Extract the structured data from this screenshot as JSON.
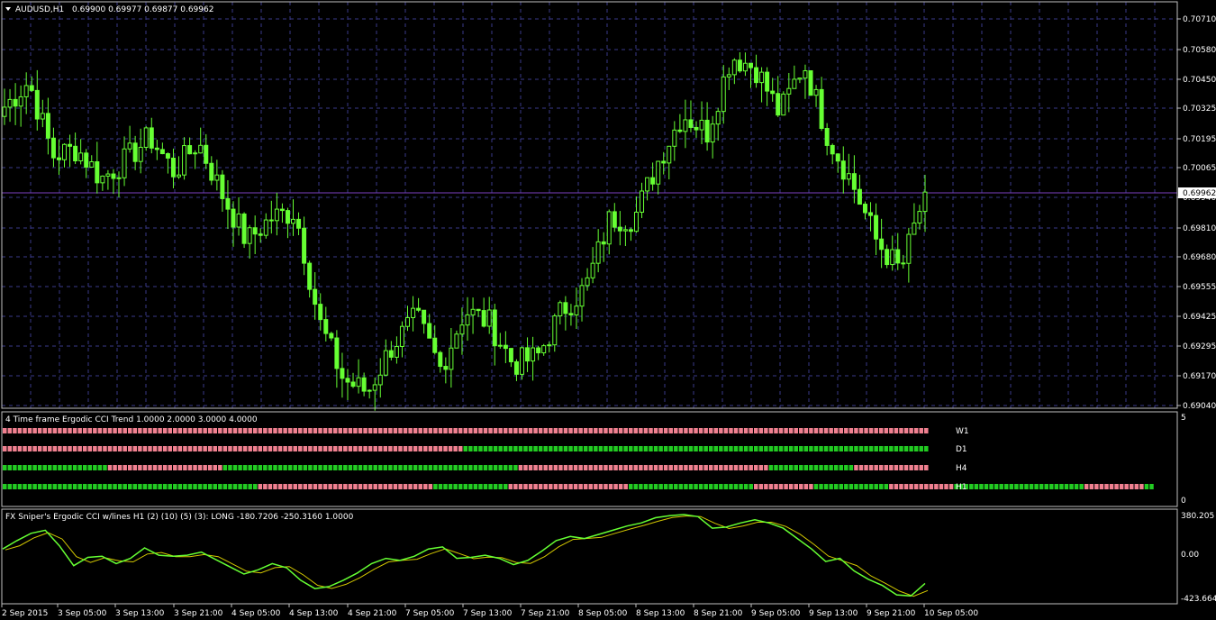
{
  "colors": {
    "background": "#000000",
    "frame": "#c0c0c0",
    "grid": "#3a3a8a",
    "candle": "#66ff33",
    "bid_line": "#7b3fbf",
    "trend_up": "#22cc22",
    "trend_down": "#f08090",
    "cci_main": "#66ff33",
    "cci_signal": "#d4c800"
  },
  "main_chart": {
    "header_icon": "triangle-down-icon",
    "symbol": "AUDUSD,H1",
    "ohlc": "0.69900 0.69977 0.69877 0.69962",
    "price_ticks": [
      "0.70710",
      "0.70580",
      "0.70450",
      "0.70325",
      "0.70195",
      "0.70065",
      "0.69940",
      "0.69810",
      "0.69680",
      "0.69555",
      "0.69425",
      "0.69295",
      "0.69170",
      "0.69040"
    ],
    "current_price": "0.69962"
  },
  "trend_panel": {
    "title": "4 Time frame Ergodic CCI Trend 1.0000 2.0000 3.0000 4.0000",
    "scale_top": "5",
    "scale_bottom": "0",
    "rows": [
      {
        "label": "W1",
        "segments": [
          [
            "down",
            185
          ]
        ]
      },
      {
        "label": "D1",
        "segments": [
          [
            "down",
            92
          ],
          [
            "up",
            93
          ]
        ]
      },
      {
        "label": "H4",
        "segments": [
          [
            "up",
            21
          ],
          [
            "down",
            23
          ],
          [
            "up",
            59
          ],
          [
            "down",
            50
          ],
          [
            "up",
            17
          ],
          [
            "down",
            15
          ]
        ]
      },
      {
        "label": "H1",
        "segments": [
          [
            "up",
            51
          ],
          [
            "down",
            35
          ],
          [
            "up",
            15
          ],
          [
            "down",
            24
          ],
          [
            "up",
            25
          ],
          [
            "down",
            12
          ],
          [
            "up",
            15
          ],
          [
            "down",
            13
          ],
          [
            "up",
            26
          ],
          [
            "down",
            12
          ],
          [
            "up",
            2
          ]
        ]
      }
    ]
  },
  "cci_panel": {
    "title": "FX Sniper's Ergodic CCI w/lines H1 (2) (10) (5) (3): LONG -180.7206 -250.3160 1.0000",
    "scale_ticks": [
      "380.205",
      "0.00",
      "-423.6643"
    ]
  },
  "time_axis": {
    "labels": [
      "2 Sep 2015",
      "3 Sep 05:00",
      "3 Sep 13:00",
      "3 Sep 21:00",
      "4 Sep 05:00",
      "4 Sep 13:00",
      "4 Sep 21:00",
      "7 Sep 05:00",
      "7 Sep 13:00",
      "7 Sep 21:00",
      "8 Sep 05:00",
      "8 Sep 13:00",
      "8 Sep 21:00",
      "9 Sep 05:00",
      "9 Sep 13:00",
      "9 Sep 21:00",
      "10 Sep 05:00"
    ]
  },
  "chart_data": [
    {
      "type": "candlestick",
      "title": "AUDUSD,H1",
      "ylim": [
        0.6904,
        0.7071
      ],
      "x": [
        "2 Sep 2015",
        "3 Sep 05:00",
        "3 Sep 13:00",
        "3 Sep 21:00",
        "4 Sep 05:00",
        "4 Sep 13:00",
        "4 Sep 21:00",
        "7 Sep 05:00",
        "7 Sep 13:00",
        "7 Sep 21:00",
        "8 Sep 05:00",
        "8 Sep 13:00",
        "8 Sep 21:00",
        "9 Sep 05:00",
        "9 Sep 13:00",
        "9 Sep 21:00",
        "10 Sep 05:00"
      ],
      "close_path": [
        0.7033,
        0.7044,
        0.7012,
        0.7015,
        0.7002,
        0.701,
        0.702,
        0.7005,
        0.7018,
        0.6995,
        0.6975,
        0.6985,
        0.6988,
        0.694,
        0.6915,
        0.691,
        0.693,
        0.6942,
        0.692,
        0.6945,
        0.694,
        0.6922,
        0.6925,
        0.6945,
        0.6955,
        0.6985,
        0.6985,
        0.701,
        0.703,
        0.7022,
        0.7055,
        0.705,
        0.703,
        0.7052,
        0.702,
        0.7,
        0.6975,
        0.6962,
        0.6996
      ],
      "close": 0.69962
    },
    {
      "type": "table",
      "title": "4 Time frame Ergodic CCI Trend 1.0000 2.0000 3.0000 4.0000",
      "rows": [
        "W1",
        "D1",
        "H4",
        "H1"
      ],
      "values": [
        "all down",
        "down then up",
        "up/down alternating",
        "up/down alternating"
      ]
    },
    {
      "type": "line",
      "title": "FX Sniper's Ergodic CCI w/lines H1 (2) (10) (5) (3): LONG -180.7206 -250.3160 1.0000",
      "ylim": [
        -423.6643,
        380.205
      ],
      "series": [
        {
          "values": [
            50,
            130,
            200,
            230,
            80,
            -110,
            -30,
            -20,
            -90,
            -40,
            60,
            -10,
            -20,
            -10,
            20,
            -50,
            -120,
            -190,
            -150,
            -90,
            -130,
            -250,
            -330,
            -310,
            -250,
            -180,
            -90,
            -40,
            -60,
            -20,
            50,
            70,
            -40,
            -30,
            -10,
            -40,
            -100,
            -60,
            30,
            130,
            170,
            150,
            190,
            230,
            270,
            300,
            350,
            370,
            380,
            360,
            250,
            260,
            300,
            330,
            300,
            250,
            150,
            50,
            -70,
            -40,
            -160,
            -240,
            -300,
            -390,
            -400,
            -280
          ]
        }
      ]
    }
  ]
}
